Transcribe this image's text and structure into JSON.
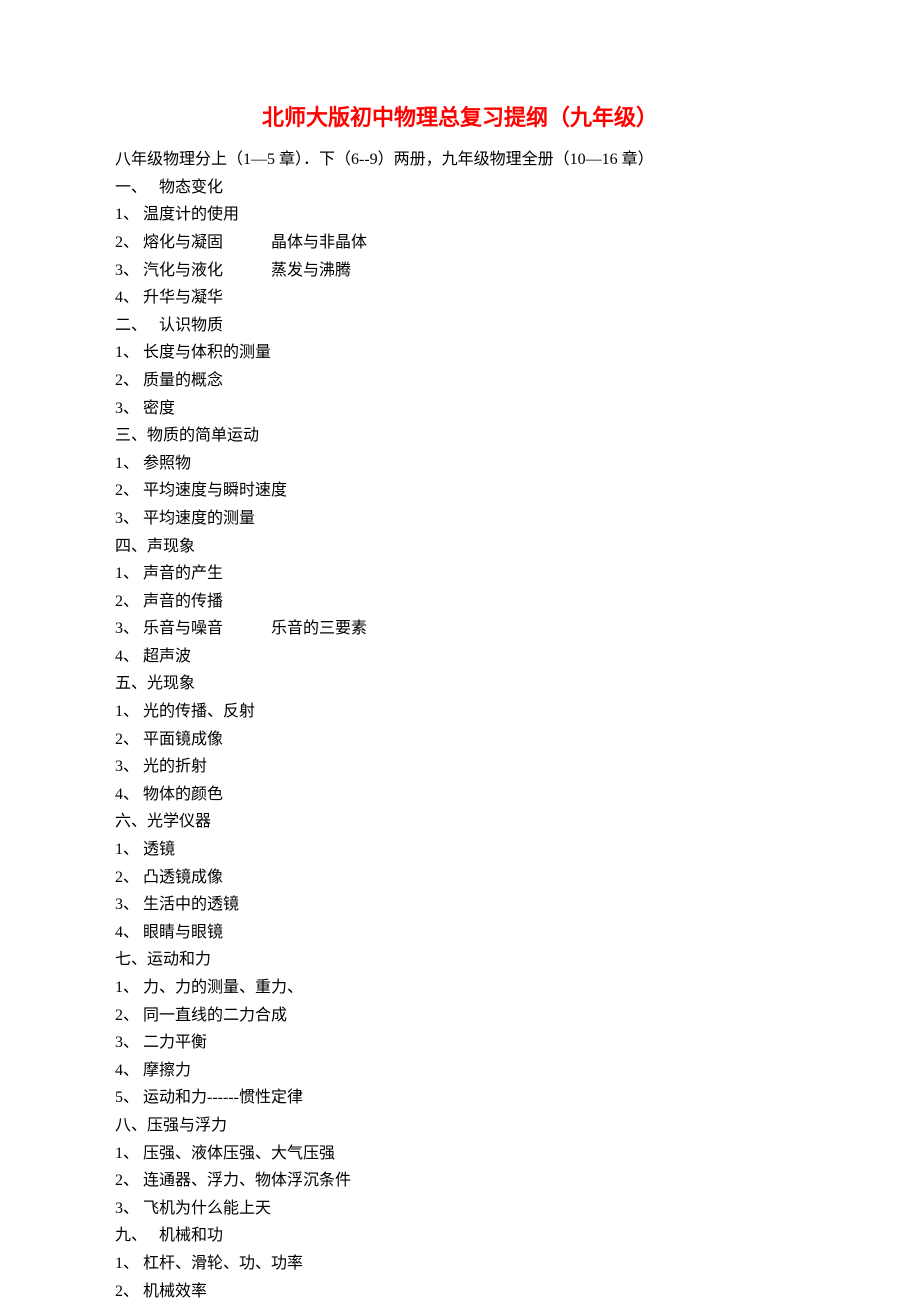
{
  "title": "北师大版初中物理总复习提纲（九年级）",
  "subtitle": "八年级物理分上（1—5 章）．下（6--9）两册，九年级物理全册（10—16 章）",
  "sections": [
    {
      "header": "一、　 物态变化",
      "items": [
        [
          "1、 温度计的使用"
        ],
        [
          "2、 熔化与凝固",
          "晶体与非晶体"
        ],
        [
          "3、 汽化与液化",
          "蒸发与沸腾"
        ],
        [
          "4、 升华与凝华"
        ]
      ]
    },
    {
      "header": "二、　 认识物质",
      "items": [
        [
          "1、 长度与体积的测量"
        ],
        [
          "2、 质量的概念"
        ],
        [
          "3、 密度"
        ]
      ]
    },
    {
      "header": "三、物质的简单运动",
      "items": [
        [
          "1、 参照物"
        ],
        [
          "2、 平均速度与瞬时速度"
        ],
        [
          "3、 平均速度的测量"
        ]
      ]
    },
    {
      "header": "四、声现象",
      "items": [
        [
          "1、 声音的产生"
        ],
        [
          "2、 声音的传播"
        ],
        [
          "3、 乐音与噪音",
          "乐音的三要素"
        ],
        [
          "4、 超声波"
        ]
      ]
    },
    {
      "header": "五、光现象",
      "items": [
        [
          "1、 光的传播、反射"
        ],
        [
          "2、 平面镜成像"
        ],
        [
          "3、 光的折射"
        ],
        [
          "4、 物体的颜色"
        ]
      ]
    },
    {
      "header": "六、光学仪器",
      "items": [
        [
          "1、 透镜"
        ],
        [
          "2、 凸透镜成像"
        ],
        [
          "3、 生活中的透镜"
        ],
        [
          "4、 眼睛与眼镜"
        ]
      ]
    },
    {
      "header": "七、运动和力",
      "items": [
        [
          "1、 力、力的测量、重力、"
        ],
        [
          "2、 同一直线的二力合成"
        ],
        [
          "3、 二力平衡"
        ],
        [
          "4、 摩擦力"
        ],
        [
          "5、 运动和力------惯性定律"
        ]
      ]
    },
    {
      "header": "八、压强与浮力",
      "items": [
        [
          "1、 压强、液体压强、大气压强"
        ],
        [
          "2、 连通器、浮力、物体浮沉条件"
        ],
        [
          "3、 飞机为什么能上天"
        ]
      ]
    },
    {
      "header": "九、　 机械和功",
      "items": [
        [
          "1、 杠杆、滑轮、功、功率"
        ],
        [
          "2、 机械效率"
        ]
      ]
    }
  ]
}
